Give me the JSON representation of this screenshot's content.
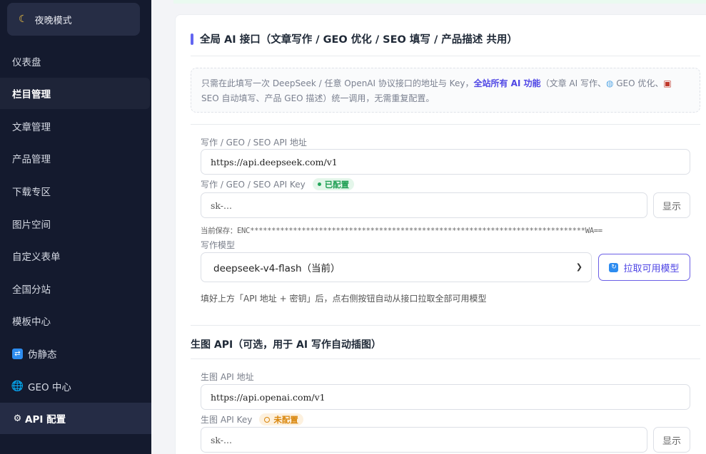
{
  "sidebar": {
    "night_mode": {
      "icon": "moon-icon",
      "label": "夜晚模式"
    },
    "items": [
      {
        "label": "仪表盘"
      },
      {
        "label": "栏目管理"
      },
      {
        "label": "文章管理"
      },
      {
        "label": "产品管理"
      },
      {
        "label": "下载专区"
      },
      {
        "label": "图片空间"
      },
      {
        "label": "自定义表单"
      },
      {
        "label": "全国分站"
      },
      {
        "label": "模板中心"
      },
      {
        "label": "伪静态",
        "icon": "sync-icon"
      },
      {
        "label": "GEO 中心",
        "icon": "globe-icon"
      },
      {
        "label": "API 配置",
        "icon": "gear-icon"
      }
    ]
  },
  "main": {
    "section1": {
      "title": "全局 AI 接口（文章写作 / GEO 优化 / SEO 填写 / 产品描述 共用）",
      "notice": {
        "pre": "只需在此填写一次 DeepSeek / 任意 OpenAI 协议接口的地址与 Key，",
        "bold": "全站所有 AI 功能",
        "mid1": "（文章 AI 写作、",
        "mid2": " GEO 优化、",
        "mid3": " SEO 自动填写、产品 GEO 描述）统一调用，无需重复配置。"
      },
      "api_url_label": "写作 / GEO / SEO API 地址",
      "api_url_value": "https://api.deepseek.com/v1",
      "api_key_label": "写作 / GEO / SEO API Key",
      "api_key_badge": "已配置",
      "api_key_placeholder": "sk-...",
      "show_label": "显示",
      "saved_text": "当前保存：ENC******************************************************************************WA==",
      "model_label": "写作模型",
      "model_selected": "deepseek-v4-flash（当前）",
      "fetch_models_label": "拉取可用模型",
      "hint": "填好上方「API 地址 + 密钥」后，点右侧按钮自动从接口拉取全部可用模型"
    },
    "section2": {
      "title": "生图 API（可选，用于 AI 写作自动插图）",
      "url_label": "生图 API 地址",
      "url_value": "https://api.openai.com/v1",
      "key_label": "生图 API Key",
      "key_badge": "未配置",
      "key_placeholder": "sk-...",
      "show_label": "显示"
    }
  },
  "colors": {
    "sidebar_bg": "#141a2e",
    "accent": "#6366f1",
    "badge_ok": "#1e9e52",
    "badge_warn": "#d9860b"
  }
}
